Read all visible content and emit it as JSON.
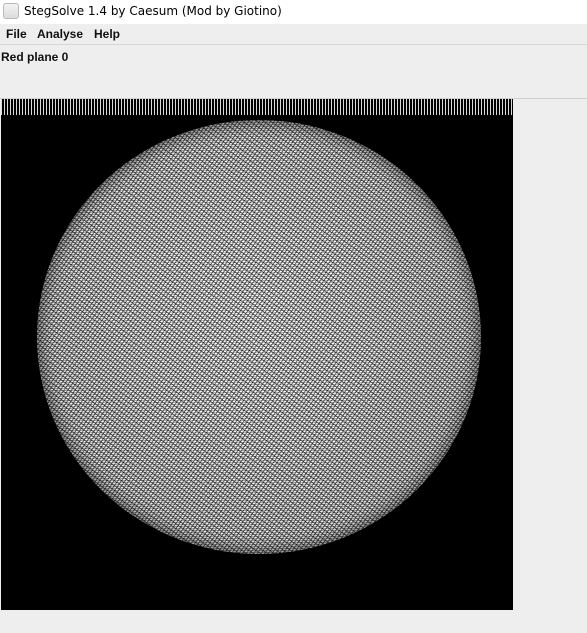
{
  "window": {
    "title": "StegSolve 1.4 by Caesum (Mod by Giotino)"
  },
  "menu": {
    "file": "File",
    "analyse": "Analyse",
    "help": "Help"
  },
  "view": {
    "mode_label": "Red plane 0"
  },
  "colors": {
    "window_bg": "#eeeeee",
    "image_bg": "#000000"
  }
}
